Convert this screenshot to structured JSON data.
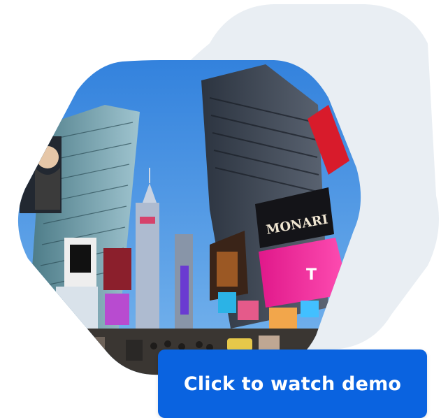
{
  "colors": {
    "background_hexagon": "#e9eef3",
    "button_bg": "#0a63e0",
    "button_text": "#ffffff",
    "sky": "#3f8fe3"
  },
  "image": {
    "subject": "times-square-street-view",
    "billboard_text": [
      "MONARI",
      "T"
    ]
  },
  "cta": {
    "label": "Click to watch demo"
  }
}
